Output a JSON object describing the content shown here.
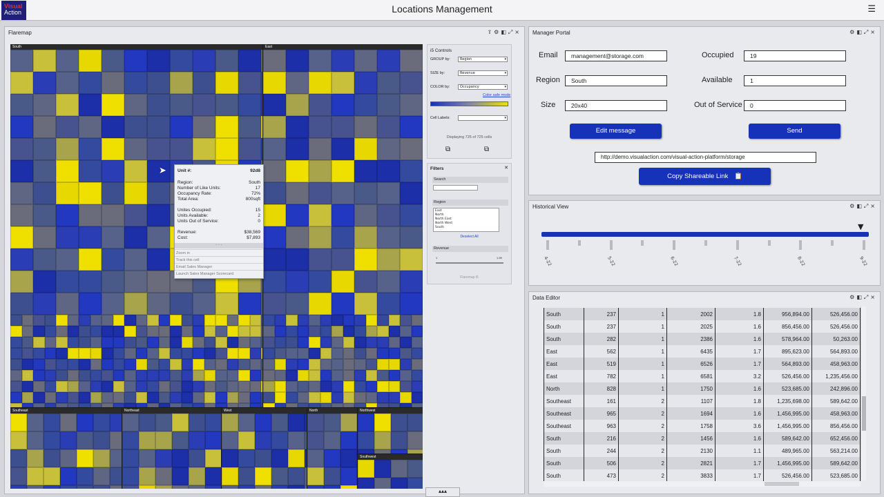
{
  "app": {
    "title": "Locations Management",
    "logo_line1": "Visual",
    "logo_line2": "Action",
    "menu_icon": "hamburger-icon"
  },
  "flaremap": {
    "title": "Flaremap",
    "sections": [
      "South",
      "East",
      "Southeast",
      "Northeast",
      "West",
      "North",
      "Northwest",
      "Southwest"
    ],
    "tooltip": {
      "unit_label": "Unit #:",
      "unit_value": "92d8",
      "rows": [
        {
          "k": "Region:",
          "v": "South"
        },
        {
          "k": "Number of Like Units:",
          "v": "17"
        },
        {
          "k": "Occupancy Rate:",
          "v": "72%"
        },
        {
          "k": "Total Area:",
          "v": "800sqft"
        },
        {
          "k": "Unites Occupied:",
          "v": "15"
        },
        {
          "k": "Units Available:",
          "v": "2"
        },
        {
          "k": "Units Out of Service:",
          "v": "0"
        },
        {
          "k": "Revenue:",
          "v": "$38,569"
        },
        {
          "k": "Cost:",
          "v": "$7,893"
        }
      ],
      "separator": "- - -",
      "actions": [
        "Zoom in",
        "Track this cell",
        "Email Sales Manager",
        "Launch Sales Manager Scorecard"
      ]
    }
  },
  "controls": {
    "title": "i5 Controls",
    "group_by": {
      "label": "GROUP by:",
      "value": "Region"
    },
    "size_by": {
      "label": "SIZE by:",
      "value": "Revenue"
    },
    "color_by": {
      "label": "COLOR by:",
      "value": "Occupancy"
    },
    "color_safe": "Color safe mode",
    "cell_labels": {
      "label": "Cell Labels:",
      "value": ""
    },
    "displaying": "Displaying 725 of 725 cells",
    "colors": {
      "low": "#1532b8",
      "high": "#f0e000"
    }
  },
  "filters": {
    "title": "Filters",
    "search_label": "Search",
    "region_label": "Region",
    "regions": [
      "East",
      "North",
      "North East",
      "North West",
      "South"
    ],
    "deselect": "Deselect All",
    "revenue_label": "Revenue",
    "revenue_min": "1",
    "revenue_max": "1.99",
    "footer": "Flaremap i5"
  },
  "manager": {
    "title": "Manager  Portal",
    "email_label": "Email",
    "email": "management@storage.com",
    "region_label": "Region",
    "region": "South",
    "size_label": "Size",
    "size": "20x40",
    "occupied_label": "Occupied",
    "occupied": "19",
    "available_label": "Available",
    "available": "1",
    "oos_label": "Out of Service",
    "oos": "0",
    "edit_button": "Edit message",
    "send_button": "Send",
    "url": "http://demo.visualaction.com/visual-action-platform/storage",
    "copy_button": "Copy Shareable Link"
  },
  "history": {
    "title": "Historical View",
    "labels": [
      "4-22",
      "5-22",
      "6-22",
      "7-22",
      "8-22",
      "9-22"
    ]
  },
  "editor": {
    "title": "Data Editor",
    "rows": [
      [
        "South",
        "237",
        "1",
        "2002",
        "1.8",
        "956,894.00",
        "526,456.00"
      ],
      [
        "South",
        "237",
        "1",
        "2025",
        "1.6",
        "856,456.00",
        "526,456.00"
      ],
      [
        "South",
        "282",
        "1",
        "2386",
        "1.6",
        "578,964.00",
        "50,263.00"
      ],
      [
        "East",
        "562",
        "1",
        "6435",
        "1.7",
        "895,623.00",
        "564,893.00"
      ],
      [
        "East",
        "519",
        "1",
        "6526",
        "1.7",
        "564,893.00",
        "458,963.00"
      ],
      [
        "East",
        "782",
        "1",
        "6581",
        "3.2",
        "526,456.00",
        "1,235,456.00"
      ],
      [
        "North",
        "828",
        "1",
        "1750",
        "1.6",
        "523,685.00",
        "242,896.00"
      ],
      [
        "Southeast",
        "161",
        "2",
        "1107",
        "1.8",
        "1,235,698.00",
        "589,642.00"
      ],
      [
        "Southeast",
        "965",
        "2",
        "1694",
        "1.6",
        "1,456,995.00",
        "458,963.00"
      ],
      [
        "Southeast",
        "963",
        "2",
        "1758",
        "3.6",
        "1,456,995.00",
        "856,456.00"
      ],
      [
        "South",
        "216",
        "2",
        "1456",
        "1.6",
        "589,642.00",
        "652,456.00"
      ],
      [
        "South",
        "244",
        "2",
        "2130",
        "1.1",
        "489,965.00",
        "563,214.00"
      ],
      [
        "South",
        "506",
        "2",
        "2821",
        "1.7",
        "1,456,995.00",
        "589,642.00"
      ],
      [
        "South",
        "473",
        "2",
        "3833",
        "1.7",
        "526,456.00",
        "523,685.00"
      ]
    ]
  },
  "bottom_tab": "▴▴▴"
}
